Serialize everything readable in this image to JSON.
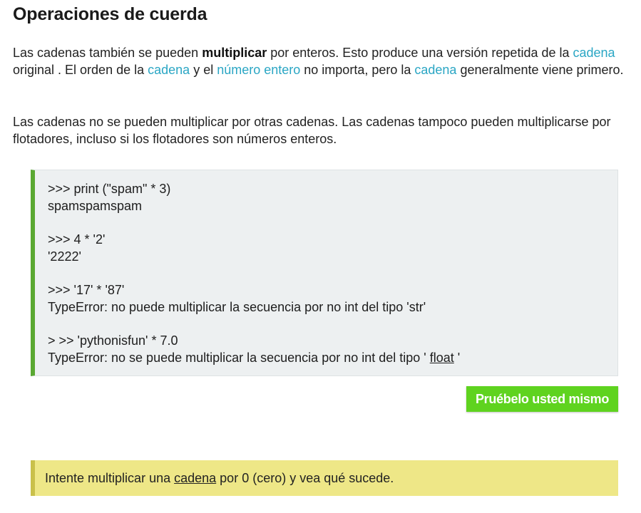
{
  "title": "Operaciones de cuerda",
  "paragraph1": {
    "t1": "Las cadenas también se pueden ",
    "bold": "multiplicar",
    "t2": " por enteros. Esto produce una versión repetida de la ",
    "link1": "cadena",
    "t3": " original . El orden de la ",
    "link2": "cadena",
    "t4": " y el ",
    "link3": "número entero",
    "t5": " no importa, pero la ",
    "link4": "cadena",
    "t6": " generalmente viene primero."
  },
  "paragraph2": "Las cadenas no se pueden multiplicar por otras cadenas. Las cadenas tampoco pueden multiplicarse por flotadores, incluso si los flotadores son números enteros.",
  "code": {
    "l1": ">>> print (\"spam\" * 3)",
    "l2": "spamspamspam",
    "l3": ">>> 4 * '2'",
    "l4": "'2222'",
    "l5": ">>> '17' * '87'",
    "l6": "TypeError: no puede multiplicar la secuencia por no int del tipo 'str'",
    "l7": "> >> 'pythonisfun' * 7.0",
    "l8_prefix": "TypeError: no se puede multiplicar la secuencia por no int del tipo ' ",
    "l8_link": "float",
    "l8_suffix": " '"
  },
  "button": {
    "label": "Pruébelo usted mismo"
  },
  "hint": {
    "prefix": "Intente multiplicar una ",
    "link": "cadena",
    "suffix": " por 0 (cero) y vea qué sucede."
  },
  "colors": {
    "link": "#2aa6c4",
    "code_bar": "#5aa832",
    "code_bg": "#edf0f1",
    "button_bg": "#5fd31f",
    "hint_bg": "#eee787",
    "hint_bar": "#c9c04b"
  }
}
